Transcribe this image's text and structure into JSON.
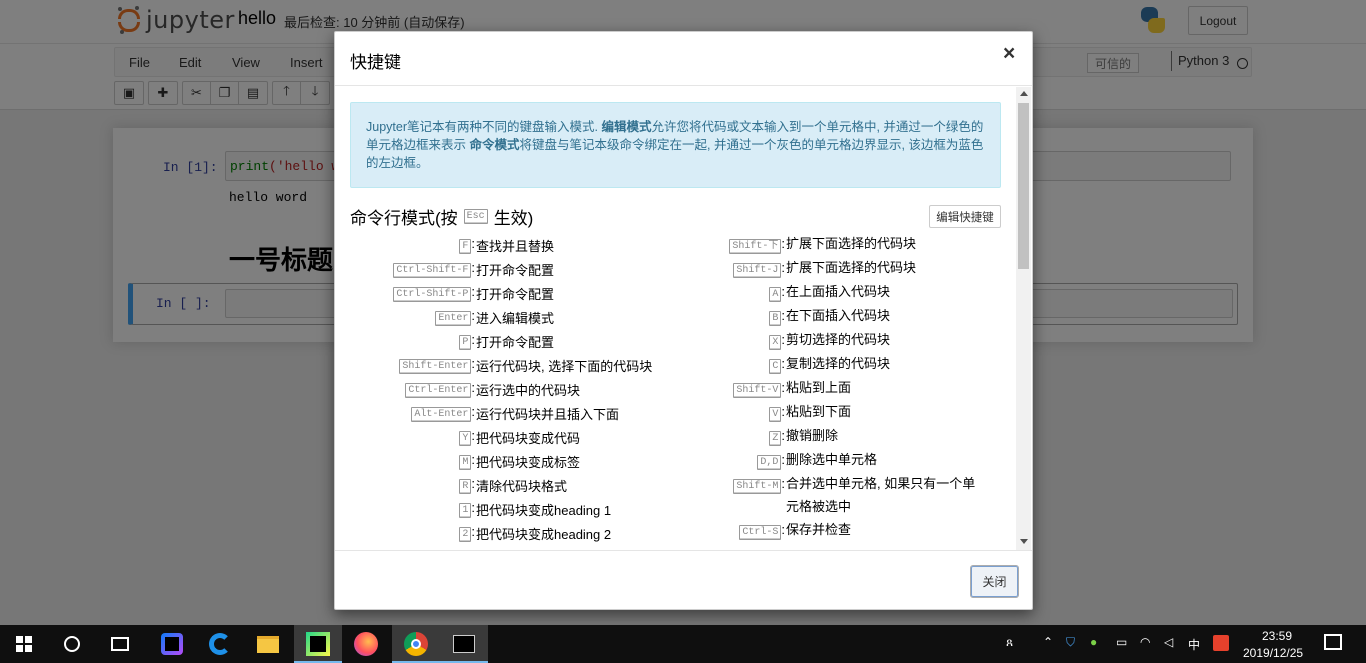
{
  "header": {
    "logo_text": "jupyter",
    "notebook_name": "hello",
    "checkpoint": "最后检查: 10 分钟前 (自动保存)",
    "logout_label": "Logout"
  },
  "menubar": {
    "items": [
      "File",
      "Edit",
      "View",
      "Insert"
    ],
    "trusted_label": "可信的",
    "kernel_name": "Python 3"
  },
  "notebook": {
    "cell1_prompt": "In  [1]:",
    "cell1_code_fn": "print",
    "cell1_code_str": "('hello wo",
    "cell1_output": "hello word",
    "heading": "一号标题",
    "cell2_prompt": "In  [ ]:"
  },
  "modal": {
    "title": "快捷键",
    "close_symbol": "×",
    "alert_part1": "Jupyter笔记本有两种不同的键盘输入模式. ",
    "alert_edit_mode": "编辑模式",
    "alert_part2": "允许您将代码或文本输入到一个单元格中, 并通过一个绿色的单元格边框来表示 ",
    "alert_command_mode": "命令模式",
    "alert_part3": "将键盘与笔记本级命令绑定在一起, 并通过一个灰色的单元格边界显示, 该边框为蓝色的左边框。",
    "section_title_pre": "命令行模式(按",
    "section_title_key": "Esc",
    "section_title_post": "生效)",
    "edit_shortcuts_label": "编辑快捷键",
    "left_shortcuts": [
      {
        "keys": "F",
        "desc": "查找并且替换"
      },
      {
        "keys": "Ctrl-Shift-F",
        "desc": "打开命令配置"
      },
      {
        "keys": "Ctrl-Shift-P",
        "desc": "打开命令配置"
      },
      {
        "keys": "Enter",
        "desc": "进入编辑模式"
      },
      {
        "keys": "P",
        "desc": "打开命令配置"
      },
      {
        "keys": "Shift-Enter",
        "desc": "运行代码块, 选择下面的代码块"
      },
      {
        "keys": "Ctrl-Enter",
        "desc": "运行选中的代码块"
      },
      {
        "keys": "Alt-Enter",
        "desc": "运行代码块并且插入下面"
      },
      {
        "keys": "Y",
        "desc": "把代码块变成代码"
      },
      {
        "keys": "M",
        "desc": "把代码块变成标签"
      },
      {
        "keys": "R",
        "desc": "清除代码块格式"
      },
      {
        "keys": "1",
        "desc": "把代码块变成heading 1"
      },
      {
        "keys": "2",
        "desc": "把代码块变成heading 2"
      }
    ],
    "right_shortcuts": [
      {
        "keys": "Shift-下",
        "desc": "扩展下面选择的代码块"
      },
      {
        "keys": "Shift-J",
        "desc": "扩展下面选择的代码块"
      },
      {
        "keys": "A",
        "desc": "在上面插入代码块"
      },
      {
        "keys": "B",
        "desc": "在下面插入代码块"
      },
      {
        "keys": "X",
        "desc": "剪切选择的代码块"
      },
      {
        "keys": "C",
        "desc": "复制选择的代码块"
      },
      {
        "keys": "Shift-V",
        "desc": "粘贴到上面"
      },
      {
        "keys": "V",
        "desc": "粘贴到下面"
      },
      {
        "keys": "Z",
        "desc": "撤销删除"
      },
      {
        "keys": "D,D",
        "desc": "删除选中单元格"
      },
      {
        "keys": "Shift-M",
        "desc": "合并选中单元格, 如果只有一个单元格被选中"
      },
      {
        "keys": "Ctrl-S",
        "desc": "保存并检查"
      }
    ],
    "close_button_label": "关闭"
  },
  "taskbar": {
    "ime_label": "中",
    "time": "23:59",
    "date": "2019/12/25"
  }
}
